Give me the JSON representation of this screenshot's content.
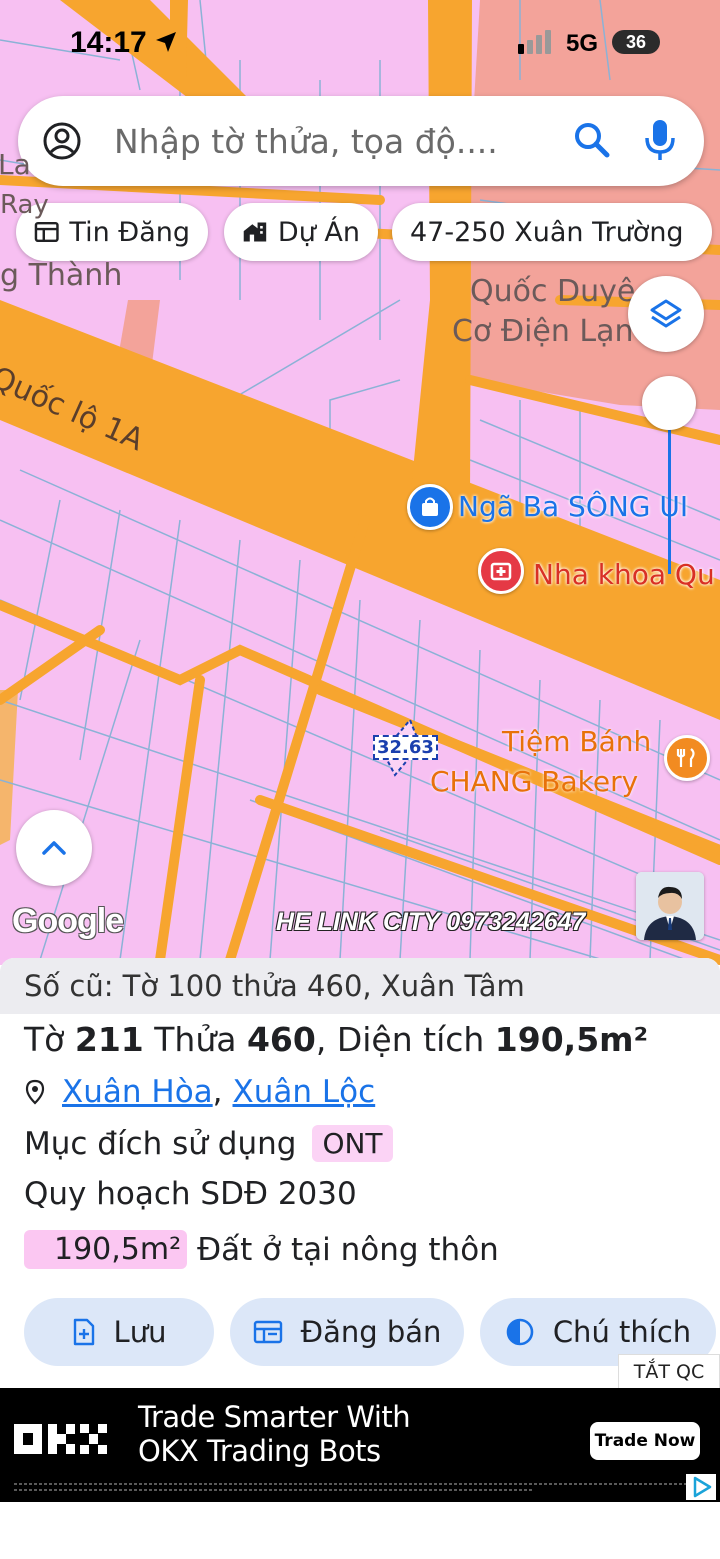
{
  "status_bar": {
    "time": "14:17",
    "network": "5G",
    "battery": "36"
  },
  "search": {
    "placeholder": "Nhập tờ thửa, tọa độ...."
  },
  "chips": [
    {
      "label": "Tin Đăng",
      "icon": "newspaper-icon"
    },
    {
      "label": "Dự Án",
      "icon": "buildings-icon"
    },
    {
      "label": "47-250 Xuân Trường"
    }
  ],
  "map": {
    "labels": {
      "road": "Quốc lộ 1A",
      "partial_left_1": "La",
      "partial_left_2": "Ray",
      "partial_left_3": "g Thành",
      "poi_duyen_1": "Quốc Duyê",
      "poi_duyen_2": "Cơ Điện Lạn",
      "poi_nga_ba": "Ngã Ba SÔNG UI",
      "poi_nha_khoa": "Nha khoa Qu",
      "poi_bakery_1": "Tiệm Bánh",
      "poi_bakery_2": "CHANG Bakery",
      "parcel_tag": "32.63"
    },
    "google": "Google",
    "watermark": "HE LINK CITY 0973242647"
  },
  "panel": {
    "old_number": "Số cũ: Tờ 100 thửa 460, Xuân Tâm",
    "parcel": {
      "to_label": "Tờ",
      "to_value": "211",
      "thua_label": "Thửa",
      "thua_value": "460",
      "dt_label": ", Diện tích",
      "dt_value": "190,5m²"
    },
    "location": {
      "commune": "Xuân Hòa",
      "separator": ",",
      "district": "Xuân Lộc"
    },
    "purpose": {
      "label": "Mục đích sử dụng",
      "code": "ONT"
    },
    "plan": "Quy hoạch SDĐ 2030",
    "area": {
      "value": "190,5m²",
      "type": "Đất ở tại nông thôn"
    },
    "actions": {
      "save": "Lưu",
      "post": "Đăng bán",
      "legend": "Chú thích"
    },
    "hide_ads": "TẮT QC"
  },
  "ad": {
    "line1": "Trade Smarter With",
    "line2": "OKX Trading Bots",
    "cta": "Trade Now"
  },
  "colors": {
    "land_pink": "#f7c0f2",
    "road_orange": "#f7a52f",
    "parcel_line": "#8bb2d6",
    "accent_blue": "#1a73e8",
    "button_bg": "#dce7f8"
  }
}
